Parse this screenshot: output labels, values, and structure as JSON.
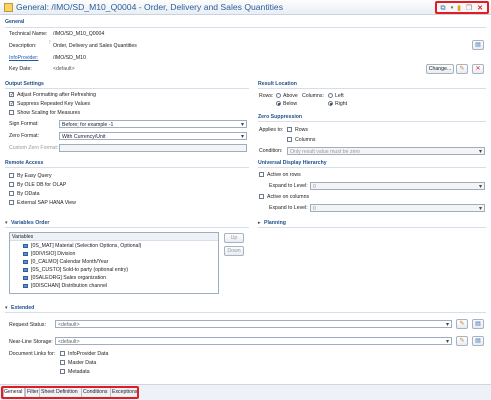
{
  "title": "General: /IMO/SD_M10_Q0004 - Order, Delivery and Sales Quantities",
  "general": {
    "section": "General",
    "technical_name_label": "Technical Name:",
    "technical_name": "/IMO/SD_M10_Q0004",
    "description_label": "Description:",
    "description": "Order, Delivery and Sales Quantities",
    "infoprovider_label": "InfoProvider:",
    "infoprovider": "/IMO/SD_M10",
    "key_date_label": "Key Date:",
    "key_date": "<default>",
    "change_button": "Change..."
  },
  "output_settings": {
    "section": "Output Settings",
    "adjust_formatting": "Adjust Formatting after Refreshing",
    "suppress_repeated": "Suppress Repeated Key Values",
    "show_scaling": "Show Scaling for Measures",
    "sign_format_label": "Sign Format:",
    "sign_format": "Before; for example -1",
    "zero_format_label": "Zero Format:",
    "zero_format": "With Currency/Unit",
    "custom_zero_label": "Custom Zero Format:"
  },
  "result_location": {
    "section": "Result Location",
    "rows_label": "Rows:",
    "above": "Above",
    "below": "Below",
    "columns_label": "Columns:",
    "left": "Left",
    "right": "Right"
  },
  "zero_suppression": {
    "section": "Zero Suppression",
    "applies_to_label": "Applies to:",
    "rows": "Rows",
    "columns": "Columns",
    "condition_label": "Condition:",
    "condition": "Only result value must be zero"
  },
  "remote_access": {
    "section": "Remote Access",
    "by_easy_query": "By Easy Query",
    "by_ole_db": "By OLE DB for OLAP",
    "by_odata": "By OData",
    "external_hana": "External SAP HANA View"
  },
  "udh": {
    "section": "Universal Display Hierarchy",
    "active_rows": "Active on rows",
    "expand_label_1": "Expand to Level:",
    "expand_value_1": "0",
    "active_columns": "Active on columns",
    "expand_label_2": "Expand to Level:",
    "expand_value_2": "0"
  },
  "planning": {
    "section": "Planning"
  },
  "variables_order": {
    "section": "Variables Order",
    "list_header": "Variables",
    "items": [
      "[0S_MAT] Material (Selection Options, Optional)",
      "[0DIVISIO] Division",
      "[0_CALMO] Calendar Month/Year",
      "[0S_CUSTO] Sold-to party (optional entry)",
      "[0SALEORG] Sales organization",
      "[0DISCHAN] Distribution channel"
    ],
    "up": "Up",
    "down": "Down"
  },
  "extended": {
    "section": "Extended",
    "request_status_label": "Request Status:",
    "request_status": "<default>",
    "nearline_label": "Near-Line Storage:",
    "nearline": "<default>",
    "doc_links_label": "Document Links for:",
    "infoprovider_data": "InfoProvider Data",
    "master_data": "Master Data",
    "metadata": "Metadata"
  },
  "tabs": [
    "General",
    "Filter",
    "Sheet Definition",
    "Conditions",
    "Exceptions"
  ]
}
